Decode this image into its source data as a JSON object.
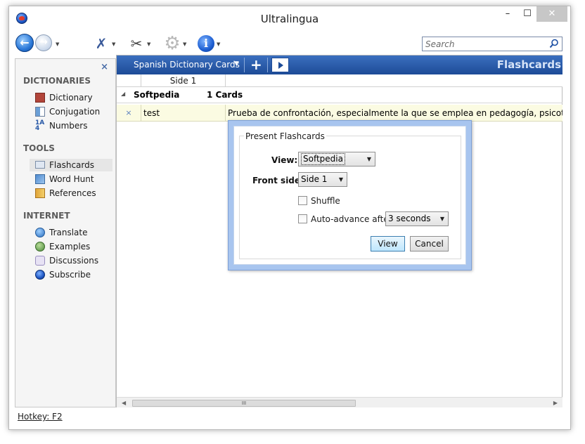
{
  "window": {
    "title": "Ultralingua",
    "minimize": "–",
    "maximize": "☐",
    "close": "✕"
  },
  "toolbar": {
    "back_icon": "arrow-left-icon",
    "forward_icon": "arrow-right-icon",
    "tools_icon": "tools-icon",
    "scissors_icon": "scissors-icon",
    "gear_icon": "gear-icon",
    "info_icon": "info-icon",
    "search_placeholder": "Search"
  },
  "sidebar": {
    "close": "×",
    "sections": [
      {
        "heading": "DICTIONARIES",
        "items": [
          {
            "label": "Dictionary",
            "icon": "book-icon"
          },
          {
            "label": "Conjugation",
            "icon": "conjugation-icon"
          },
          {
            "label": "Numbers",
            "icon": "numbers-icon"
          }
        ]
      },
      {
        "heading": "TOOLS",
        "items": [
          {
            "label": "Flashcards",
            "icon": "flashcards-icon",
            "selected": true
          },
          {
            "label": "Word Hunt",
            "icon": "word-hunt-icon"
          },
          {
            "label": "References",
            "icon": "references-icon"
          }
        ]
      },
      {
        "heading": "INTERNET",
        "items": [
          {
            "label": "Translate",
            "icon": "translate-icon"
          },
          {
            "label": "Examples",
            "icon": "examples-icon"
          },
          {
            "label": "Discussions",
            "icon": "discussions-icon"
          },
          {
            "label": "Subscribe",
            "icon": "subscribe-icon"
          }
        ]
      }
    ]
  },
  "deck": {
    "title": "Spanish Dictionary Cards",
    "add": "+",
    "label": "Flashcards"
  },
  "table": {
    "header": {
      "side1": "Side 1"
    },
    "group": {
      "name": "Softpedia",
      "count": "1 Cards"
    },
    "rows": [
      {
        "delete": "×",
        "side1": "test",
        "side2": "Prueba de confrontación, especialmente la que se emplea en pedagogía, psicotecnia, medicina"
      }
    ],
    "scroll_thumb": "III"
  },
  "status": {
    "hotkey": "Hotkey: F2"
  },
  "dialog": {
    "legend": "Present Flashcards",
    "view_label": "View:",
    "view_value": "Softpedia",
    "front_label": "Front side:",
    "front_value": "Side 1",
    "shuffle_label": "Shuffle",
    "shuffle_checked": false,
    "auto_label": "Auto-advance after",
    "auto_checked": false,
    "auto_value": "3 seconds",
    "view_button": "View",
    "cancel_button": "Cancel"
  },
  "colors": {
    "deck_bar": "#2a5aa8",
    "dialog_frame": "#a8c5ef",
    "row_highlight": "#fbfbe2"
  }
}
